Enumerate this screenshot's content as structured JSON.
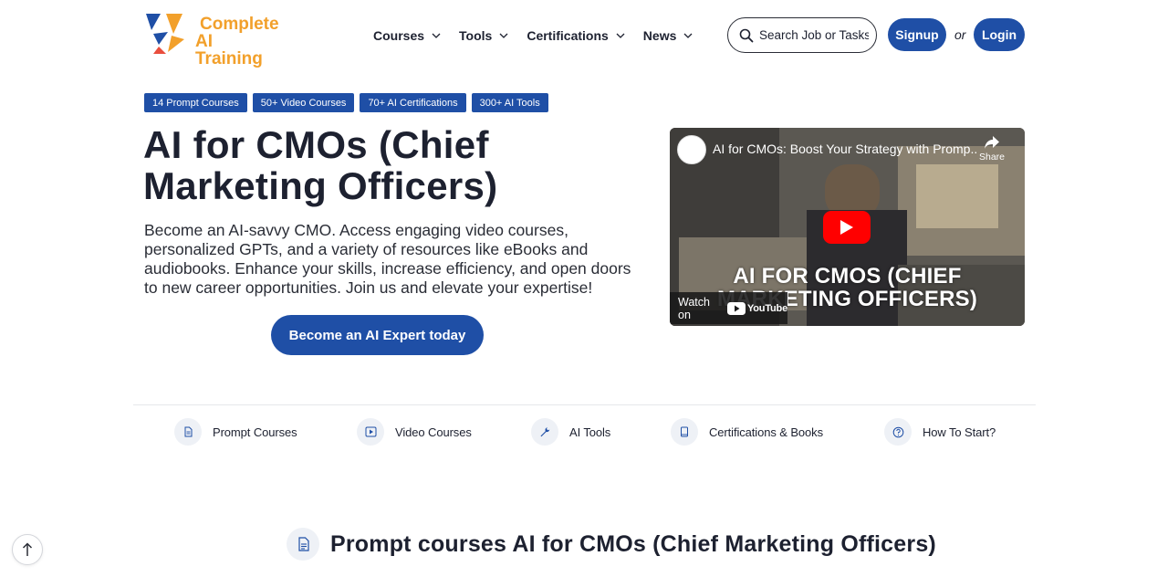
{
  "brand": {
    "logo_line1": "Complete",
    "logo_line2": "AI Training",
    "accent_color": "#1f4fa6",
    "logo_color": "#f2a02b"
  },
  "nav": {
    "items": [
      {
        "label": "Courses",
        "icon": "chevron-down-icon"
      },
      {
        "label": "Tools",
        "icon": "chevron-down-icon"
      },
      {
        "label": "Certifications",
        "icon": "chevron-down-icon"
      },
      {
        "label": "News",
        "icon": "chevron-down-icon"
      }
    ]
  },
  "search": {
    "placeholder": "Search Job or Tasks",
    "icon": "search-icon"
  },
  "auth": {
    "signup_label": "Signup",
    "or_label": "or",
    "login_label": "Login"
  },
  "tags": [
    "14 Prompt Courses",
    "50+ Video Courses",
    "70+ AI Certifications",
    "300+ AI Tools"
  ],
  "hero": {
    "title": "AI for CMOs (Chief Marketing Officers)",
    "description": "Become an AI-savvy CMO. Access engaging video courses, personalized GPTs, and a variety of resources like eBooks and audiobooks. Enhance your skills, increase efficiency, and open doors to new career opportunities. Join us and elevate your expertise!",
    "cta_label": "Become an AI Expert today"
  },
  "video": {
    "title": "AI for CMOs: Boost Your Strategy with Promp...",
    "share_label": "Share",
    "overlay_line1": "AI FOR CMOS (CHIEF",
    "overlay_line2": "MARKETING OFFICERS)",
    "watch_on_label": "Watch on",
    "youtube_label": "YouTube"
  },
  "quick_links": [
    {
      "label": "Prompt Courses",
      "icon": "document-icon"
    },
    {
      "label": "Video Courses",
      "icon": "play-icon"
    },
    {
      "label": "AI Tools",
      "icon": "wrench-icon"
    },
    {
      "label": "Certifications & Books",
      "icon": "book-icon"
    },
    {
      "label": "How To Start?",
      "icon": "help-icon"
    }
  ],
  "section": {
    "heading": "Prompt courses AI for CMOs (Chief Marketing Officers)",
    "icon": "document-icon"
  },
  "back_to_top": {
    "icon": "arrow-up-icon"
  }
}
